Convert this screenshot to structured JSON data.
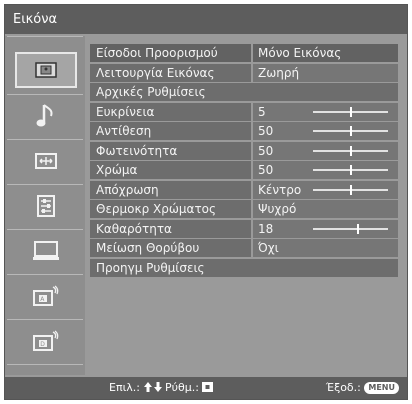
{
  "header": {
    "title": "Εικόνα"
  },
  "sidebar": {
    "items": [
      {
        "name": "picture-icon",
        "selected": true
      },
      {
        "name": "music-note-icon"
      },
      {
        "name": "screen-adjust-icon"
      },
      {
        "name": "setup-list-icon"
      },
      {
        "name": "monitor-icon"
      },
      {
        "name": "analog-tuning-icon"
      },
      {
        "name": "digital-tuning-icon"
      }
    ]
  },
  "menu": {
    "rows": [
      {
        "label": "Είσοδοι Προορισμού",
        "value": "Μόνο Εικόνας",
        "selected": true
      },
      {
        "label": "Λειτουργία Εικόνας",
        "value": "Ζωηρή"
      },
      {
        "label": "Αρχικές Ρυθμίσεις"
      },
      {
        "label": "Ευκρίνεια",
        "value": "5",
        "level": 0.5
      },
      {
        "label": "Αντίθεση",
        "value": "50",
        "level": 0.5
      },
      {
        "label": "Φωτεινότητα",
        "value": "50",
        "level": 0.5
      },
      {
        "label": "Χρώμα",
        "value": "50",
        "level": 0.5
      },
      {
        "label": "Απόχρωση",
        "value": "Κέντρο",
        "level": 0.5
      },
      {
        "label": "Θερμοκρ Χρώματος",
        "value": "Ψυχρό"
      },
      {
        "label": "Καθαρότητα",
        "value": "18",
        "level": 0.6
      },
      {
        "label": "Μείωση Θορύβου",
        "value": "Όχι"
      },
      {
        "label": "Προηγμ Ρυθμίσεις"
      }
    ]
  },
  "footer": {
    "select_label": "Επιλ.:",
    "select_icons": "up-down-arrows-icon",
    "set_label": "Ρύθμ.:",
    "set_icon": "enter-button-icon",
    "exit_label": "Έξοδ.:",
    "exit_button": "MENU"
  }
}
